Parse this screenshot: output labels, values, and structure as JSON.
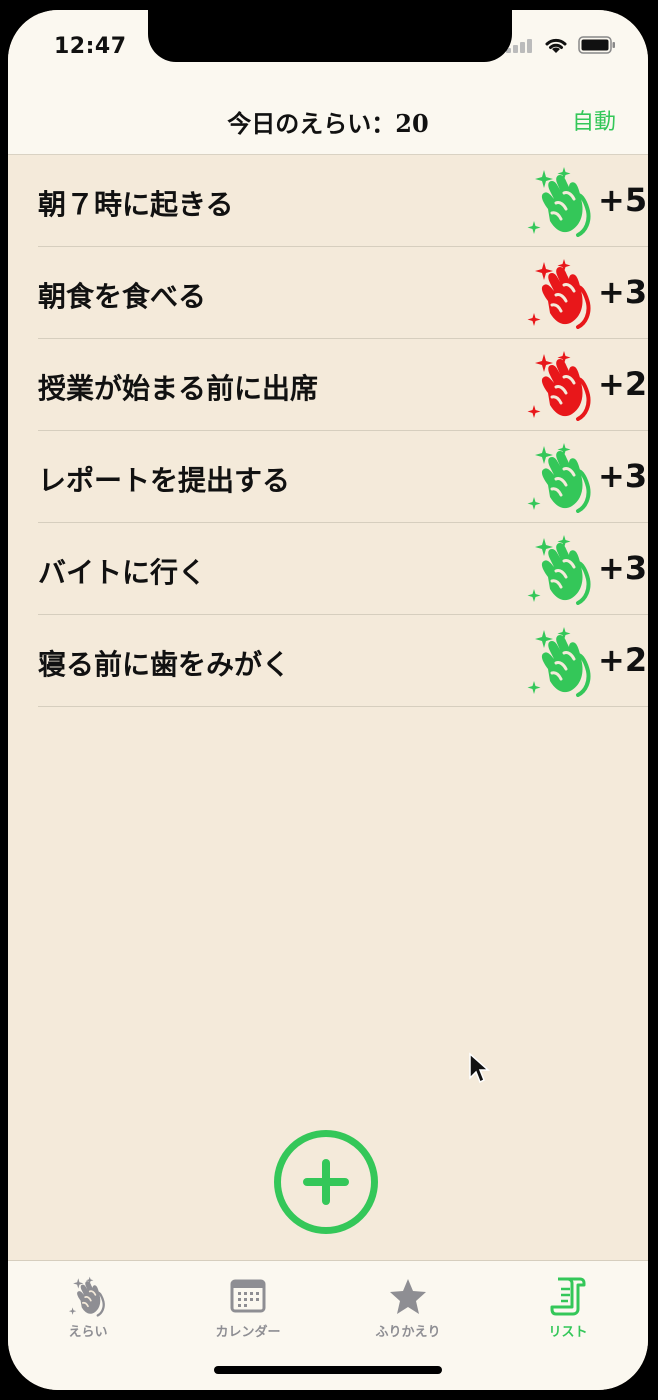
{
  "status_bar": {
    "time": "12:47"
  },
  "header": {
    "title": "今日のえらい：20",
    "auto_label": "自動"
  },
  "items": [
    {
      "label": "朝７時に起きる",
      "points": "+5",
      "clap_color": "#34c759"
    },
    {
      "label": "朝食を食べる",
      "points": "+3",
      "clap_color": "#e8171a"
    },
    {
      "label": "授業が始まる前に出席",
      "points": "+2",
      "clap_color": "#e8171a"
    },
    {
      "label": "レポートを提出する",
      "points": "+3",
      "clap_color": "#34c759"
    },
    {
      "label": "バイトに行く",
      "points": "+3",
      "clap_color": "#34c759"
    },
    {
      "label": "寝る前に歯をみがく",
      "points": "+2",
      "clap_color": "#34c759"
    }
  ],
  "tabs": [
    {
      "label": "えらい",
      "icon": "clap-icon",
      "active": false
    },
    {
      "label": "カレンダー",
      "icon": "calendar-icon",
      "active": false
    },
    {
      "label": "ふりかえり",
      "icon": "star-icon",
      "active": false
    },
    {
      "label": "リスト",
      "icon": "scroll-icon",
      "active": true
    }
  ],
  "colors": {
    "accent": "#34c759",
    "background": "#f4eada",
    "bar_background": "#fbf8f0",
    "inactive": "#8e8e93"
  }
}
